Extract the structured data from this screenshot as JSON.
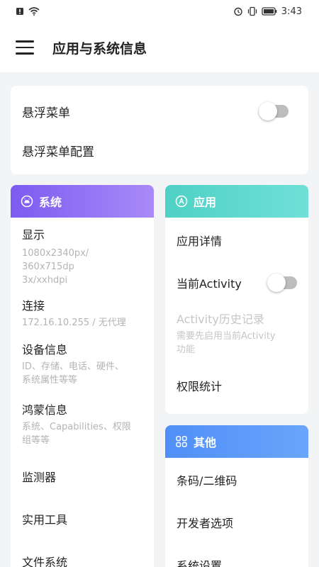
{
  "status_bar": {
    "time": "3:43"
  },
  "app_bar": {
    "title": "应用与系统信息"
  },
  "floating_menu": {
    "label": "悬浮菜单",
    "enabled": false,
    "config_label": "悬浮菜单配置"
  },
  "system": {
    "header": "系统",
    "items": [
      {
        "title": "显示",
        "subtitle_lines": [
          "1080x2340px/",
          "360x715dp",
          "3x/xxhdpi"
        ]
      },
      {
        "title": "连接",
        "subtitle": "172.16.10.255 / 无代理"
      },
      {
        "title": "设备信息",
        "subtitle_lines": [
          "ID、存储、电话、硬件、",
          "系统属性等等"
        ]
      },
      {
        "title": "鸿蒙信息",
        "subtitle_lines": [
          "系统、Capabilities、权限",
          "组等等"
        ]
      },
      {
        "title": "监测器"
      },
      {
        "title": "实用工具"
      },
      {
        "title": "文件系统"
      }
    ]
  },
  "apps": {
    "header": "应用",
    "items": [
      {
        "title": "应用详情"
      },
      {
        "title": "当前Activity",
        "toggle_enabled": false
      },
      {
        "title": "Activity历史记录",
        "subtitle_lines": [
          "需要先启用当前Activity",
          "功能"
        ]
      },
      {
        "title": "权限统计"
      }
    ]
  },
  "other": {
    "header": "其他",
    "items": [
      {
        "title": "条码/二维码"
      },
      {
        "title": "开发者选项"
      },
      {
        "title": "系统设置"
      }
    ]
  }
}
